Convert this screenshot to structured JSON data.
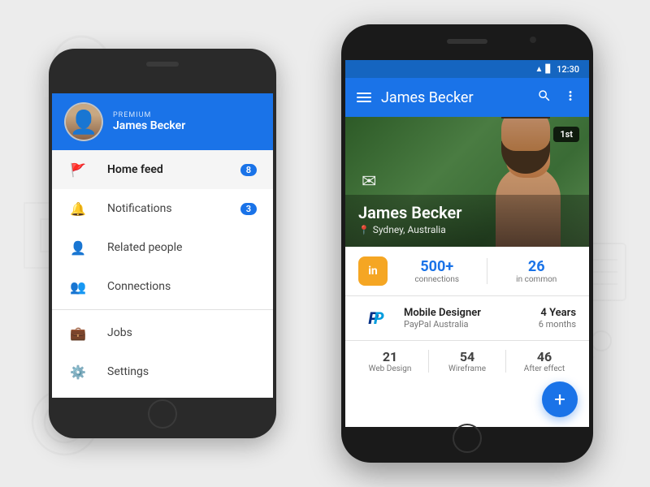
{
  "background": {
    "color": "#e8e8e8"
  },
  "phone_back": {
    "header": {
      "premium_label": "PREMIUM",
      "user_name": "James Becker"
    },
    "menu": {
      "items": [
        {
          "id": "home-feed",
          "label": "Home feed",
          "icon": "flag",
          "badge": "8",
          "active": true
        },
        {
          "id": "notifications",
          "label": "Notifications",
          "icon": "bell",
          "badge": "3",
          "active": false
        },
        {
          "id": "related-people",
          "label": "Related people",
          "icon": "person-add",
          "badge": null,
          "active": false
        },
        {
          "id": "connections",
          "label": "Connections",
          "icon": "people",
          "badge": null,
          "active": false
        },
        {
          "id": "jobs",
          "label": "Jobs",
          "icon": "briefcase",
          "badge": null,
          "active": false
        },
        {
          "id": "settings",
          "label": "Settings",
          "icon": "gear",
          "badge": null,
          "active": false
        }
      ]
    }
  },
  "phone_front": {
    "status_bar": {
      "time": "12:30",
      "signal": "▂▄▆",
      "battery": "🔋"
    },
    "app_bar": {
      "title": "James Becker",
      "search_icon": "search",
      "more_icon": "more-vert",
      "menu_icon": "hamburger"
    },
    "profile": {
      "name": "James Becker",
      "location": "Sydney, Australia",
      "connection_badge": "1st"
    },
    "stats": {
      "linkedin_label": "in",
      "connections_count": "500+",
      "connections_label": "connections",
      "common_count": "26",
      "common_label": "in common"
    },
    "job": {
      "title": "Mobile Designer",
      "company": "PayPal Australia",
      "duration_years": "4 Years",
      "duration_months": "6 months"
    },
    "skills": [
      {
        "count": "21",
        "name": "Web Design"
      },
      {
        "count": "54",
        "name": "Wireframe"
      },
      {
        "count": "46",
        "name": "After effect"
      }
    ],
    "fab_icon": "+"
  }
}
